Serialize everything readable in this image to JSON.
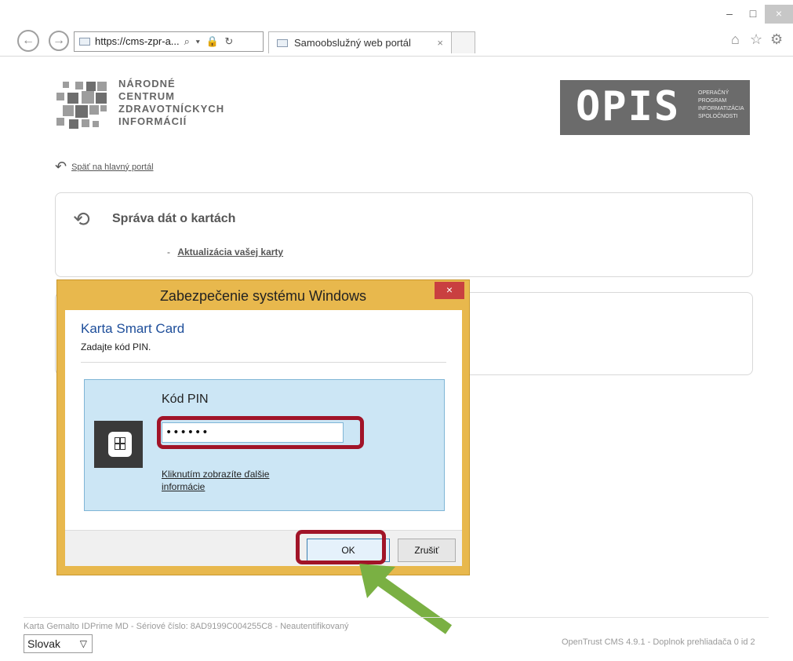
{
  "browser": {
    "address": "https://cms-zpr-a...",
    "tab_title": "Samoobslužný web portál",
    "tab_close": "×",
    "win_min": "–",
    "win_max": "□",
    "win_close": "×",
    "back": "←",
    "forward": "→",
    "addr_icons": "⌕ ▾ 🔒 ↻",
    "home_icon": "⌂",
    "favorites_icon": "☆",
    "tools_icon": "⚙"
  },
  "header": {
    "org_lines": [
      "NÁRODNÉ",
      "CENTRUM",
      "ZDRAVOTNÍCKYCH",
      "INFORMÁCIÍ"
    ],
    "opis_main": "OPIS",
    "opis_sub": [
      "OPERAČNÝ",
      "PROGRAM",
      "INFORMATIZÁCIA",
      "SPOLOČNOSTI"
    ]
  },
  "page": {
    "back_link": "Späť na hlavný portál",
    "panel_title": "Správa dát o kartách",
    "panel_item_dash": "-",
    "panel_item_link": "Aktualizácia vašej karty"
  },
  "dialog": {
    "title": "Zabezpečenie systému Windows",
    "close": "×",
    "heading": "Karta Smart Card",
    "subheading": "Zadajte kód PIN.",
    "pin_label": "Kód PIN",
    "pin_value": "••••••",
    "more_info": "Kliknutím zobrazíte ďalšie informácie",
    "ok_label": "OK",
    "cancel_label": "Zrušiť"
  },
  "footer": {
    "card_info": "Karta Gemalto IDPrime MD - Sériové číslo: 8AD9199C004255C8 - Neautentifikovaný",
    "language": "Slovak",
    "version": "OpenTrust CMS 4.9.1 - Doplnok prehliadača 0 id 2"
  },
  "colors": {
    "dialog_frame": "#e8b84d",
    "highlight": "#a11428",
    "arrow": "#7ab043",
    "pin_box": "#cce6f5"
  }
}
